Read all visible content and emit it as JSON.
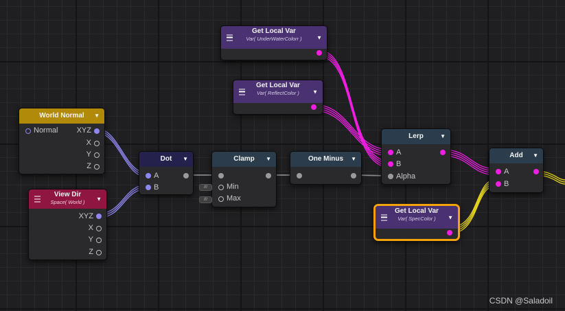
{
  "colors": {
    "local_var_header": "#4a3272",
    "world_normal_header": "#b28a0a",
    "view_dir_header": "#8f1640",
    "dot_header": "#24214c",
    "math_header": "#2b3d4c",
    "magenta_wire": "#ef1ee2",
    "blue_wire": "#8f86f0",
    "yellow_wire": "#e6d51e",
    "selection": "#f5a30b"
  },
  "nodes": {
    "get_local_var_1": {
      "title": "Get Local Var",
      "subtitle": "Var( UnderWaterColorr )"
    },
    "get_local_var_2": {
      "title": "Get Local Var",
      "subtitle": "Var( ReflectColor )"
    },
    "get_local_var_3": {
      "title": "Get Local Var",
      "subtitle": "Var( SpecColor )"
    },
    "world_normal": {
      "title": "World Normal",
      "input": "Normal",
      "outputs": [
        "XYZ",
        "X",
        "Y",
        "Z"
      ]
    },
    "view_dir": {
      "title": "View Dir",
      "subtitle": "Space( World )",
      "outputs": [
        "XYZ",
        "X",
        "Y",
        "Z"
      ]
    },
    "dot": {
      "title": "Dot",
      "inputs": [
        "A",
        "B"
      ]
    },
    "clamp": {
      "title": "Clamp",
      "inputs": [
        "Min",
        "Max"
      ]
    },
    "one_minus": {
      "title": "One Minus"
    },
    "lerp": {
      "title": "Lerp",
      "inputs": [
        "A",
        "B",
        "Alpha"
      ]
    },
    "add": {
      "title": "Add",
      "inputs": [
        "A",
        "B"
      ]
    }
  },
  "icons": {
    "menu": "hamburger-icon",
    "dropdown": "triangle-down-icon",
    "value_badge": "value-badge-icon"
  },
  "watermark": "CSDN @Saladoil"
}
